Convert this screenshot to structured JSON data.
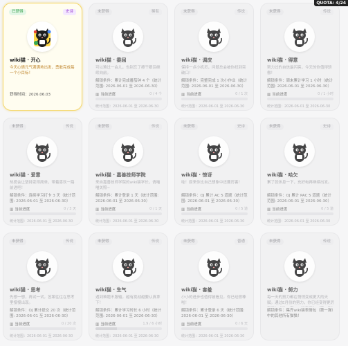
{
  "quota": "QUOTA: 4/24",
  "cards": [
    {
      "status": "已获得",
      "rarity": "史诗",
      "title": "wiki猫 · 开心",
      "desc": "今天心情元气满满地出发，勇敢完成每一个小目标！",
      "unlocked_time": "获得时间：2026.06.03",
      "state": "unlocked",
      "col": 0,
      "row": 0
    },
    {
      "status": "未获得",
      "rarity": "稀有",
      "title": "wiki猫 · 委屈",
      "desc": "可以难过一会儿，也别忘了擦干眼泪继续向前。",
      "condition": "解锁条件：累计完成番茄钟 4 个（统计范围: 2026-06-01 至 2026-06-30）",
      "progress_label": "当前进度",
      "progress_count": "0 / 4 个",
      "progress": 0.0,
      "stat_time": "统计范围：2026-06-01 至 2026-06-30",
      "state": "locked",
      "col": 1,
      "row": 0
    },
    {
      "status": "未获得",
      "rarity": "传说",
      "title": "wiki猫 · 调皮",
      "desc": "保持一点小机灵，问题总会被你找到突破口！",
      "condition": "解锁条件：完整完成 1 次小作业（统计范围: 2026-06-01 至 2026-06-30）",
      "progress_label": "当前进度",
      "progress_count": "0 / 1 次",
      "progress": 0.0,
      "stat_time": "统计范围：2026-06-01 至 2026-06-30",
      "state": "locked",
      "col": 2,
      "row": 0
    },
    {
      "status": "未获得",
      "rarity": "传说",
      "title": "wiki猫 · 得意",
      "desc": "努力过的自信最闪亮，今天的你值得骄傲！",
      "condition": "解锁条件：周末累计学习 1 小时（统计范围: 2026-06-01 至 2026-06-30）",
      "progress_label": "当前进度",
      "progress_count": "0 / 1 小时",
      "progress": 0.0,
      "stat_time": "统计范围：2026-06-01 至 2026-06-30",
      "state": "locked",
      "col": 3,
      "row": 0
    },
    {
      "status": "未获得",
      "rarity": "传说",
      "title": "wiki猫 · 爱意",
      "desc": "热爱会让坚持变得简单，带着喜欢一路前进吧！",
      "condition": "解锁条件：连续学习打卡 3 天（统计范围: 2026-06-01 至 2026-06-30）",
      "progress_label": "当前进度",
      "progress_count": "0 / 3 天",
      "progress": 0.0,
      "stat_time": "统计范围：2026-06-01 至 2026-06-30",
      "state": "locked",
      "col": 0,
      "row": 1
    },
    {
      "status": "未获得",
      "rarity": "传说",
      "title": "wiki猫 · 嘉善技师学院",
      "desc": "来自嘉善技师学院的wiki猫学长，请喵喵关照~",
      "condition": "解锁条件：累计登录 1 天（统计范围: 2026-06-01 至 2026-06-30）",
      "progress_label": "当前进度",
      "progress_count": "0 / 1 天",
      "progress": 0.0,
      "stat_time": "统计范围：2026-06-01 至 2026-06-30",
      "state": "locked",
      "col": 1,
      "row": 1
    },
    {
      "status": "未获得",
      "rarity": "史诗",
      "title": "wiki猫 · 惊讶",
      "desc": "哇！原来你比自己想象中还要厉害！",
      "condition": "解锁条件：OJ 累计 AC 5 道题（统计范围: 2026-06-01 至 2026-06-30）",
      "progress_label": "当前进度",
      "progress_count": "0 / 5 道",
      "progress": 0.0,
      "stat_time": "统计范围：2026-06-01 至 2026-06-30",
      "state": "locked",
      "col": 2,
      "row": 1
    },
    {
      "status": "未获得",
      "rarity": "史诗",
      "title": "wiki猫 · 哈欠",
      "desc": "累了就休息一下，充好电再继续出发。",
      "condition": "解锁条件：OJ 累计 PAC 5 道题（统计范围: 2026-06-01 至 2026-06-30）",
      "progress_label": "当前进度",
      "progress_count": "0 / 5 道",
      "progress": 0.0,
      "stat_time": "统计范围：2026-06-01 至 2026-06-30",
      "state": "locked",
      "col": 3,
      "row": 1
    },
    {
      "status": "未获得",
      "rarity": "传说",
      "title": "wiki猫 · 思考",
      "desc": "先想一想，再试一试，答案往往在思考里慢慢出现。",
      "condition": "解锁条件：OJ 累计提交 20 次（统计范围: 2026-06-01 至 2026-06-30）",
      "progress_label": "当前进度",
      "progress_count": "0 / 20 次",
      "progress": 0.0,
      "stat_time": "统计范围：2026-06-01 至 2026-06-30",
      "state": "locked",
      "col": 0,
      "row": 2
    },
    {
      "status": "未获得",
      "rarity": "传说",
      "title": "wiki猫 · 生气",
      "desc": "遇到难题不服输，越有挑战越要认真拿下！",
      "condition": "解锁条件：累计学习时长 6 小时（统计范围: 2026-06-01 至 2026-06-30）",
      "progress_label": "当前进度",
      "progress_count": "1.9 / 6 小时",
      "progress": 0.32,
      "stat_time": "统计范围：2026-06-01 至 2026-06-30",
      "state": "locked",
      "col": 1,
      "row": 2
    },
    {
      "status": "未获得",
      "rarity": "普通",
      "title": "wiki猫 · 害羞",
      "desc": "小小的进步也值得被看见，你已经很棒啦！",
      "condition": "解锁条件：累计登录 6 天（统计范围: 2026-06-01 至 2026-06-30）",
      "progress_label": "当前进度",
      "progress_count": "0 / 6 天",
      "progress": 0.0,
      "stat_time": "统计范围：2026-06-01 至 2026-06-30",
      "state": "locked",
      "col": 2,
      "row": 2
    },
    {
      "status": "未获得",
      "rarity": "传说",
      "title": "wiki猫 · 努力",
      "desc": "每一天的努力都在悄悄变成更大的天赋。通过E月份的努力，你已经变得更厉害了！成功一齐wiki猫表情包（第一弹）所有猫猫的奖励",
      "condition": "解锁条件：集齐wiki猫表情包（第一弹）中的其他所有猫猫！",
      "state": "locked",
      "col": 3,
      "row": 2
    }
  ]
}
